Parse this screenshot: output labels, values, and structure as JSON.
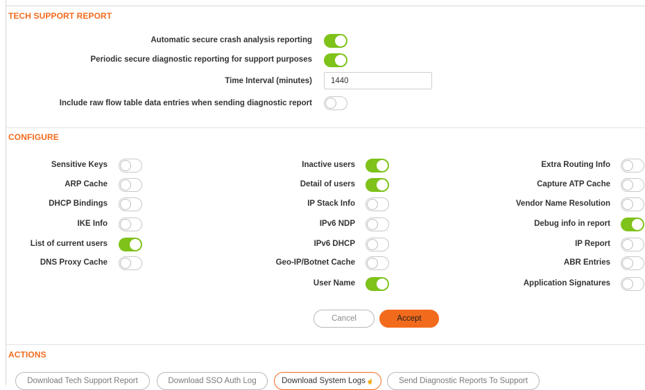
{
  "tech_support": {
    "title": "TECH SUPPORT REPORT",
    "auto_crash_label": "Automatic secure crash analysis reporting",
    "auto_crash_on": true,
    "periodic_label": "Periodic secure diagnostic reporting for support purposes",
    "periodic_on": true,
    "interval_label": "Time Interval (minutes)",
    "interval_value": "1440",
    "raw_flow_label": "Include raw flow table data entries when sending diagnostic report",
    "raw_flow_on": false
  },
  "configure": {
    "title": "CONFIGURE",
    "col1": [
      {
        "label": "Sensitive Keys",
        "on": false
      },
      {
        "label": "ARP Cache",
        "on": false
      },
      {
        "label": "DHCP Bindings",
        "on": false
      },
      {
        "label": "IKE Info",
        "on": false
      },
      {
        "label": "List of current users",
        "on": true
      },
      {
        "label": "DNS Proxy Cache",
        "on": false
      }
    ],
    "col2": [
      {
        "label": "Inactive users",
        "on": true
      },
      {
        "label": "Detail of users",
        "on": true
      },
      {
        "label": "IP Stack Info",
        "on": false
      },
      {
        "label": "IPv6 NDP",
        "on": false
      },
      {
        "label": "IPv6 DHCP",
        "on": false
      },
      {
        "label": "Geo-IP/Botnet Cache",
        "on": false
      },
      {
        "label": "User Name",
        "on": true
      }
    ],
    "col3": [
      {
        "label": "Extra Routing Info",
        "on": false
      },
      {
        "label": "Capture ATP Cache",
        "on": false
      },
      {
        "label": "Vendor Name Resolution",
        "on": false
      },
      {
        "label": "Debug info in report",
        "on": true
      },
      {
        "label": "IP Report",
        "on": false
      },
      {
        "label": "ABR Entries",
        "on": false
      },
      {
        "label": "Application Signatures",
        "on": false
      }
    ],
    "cancel_label": "Cancel",
    "accept_label": "Accept"
  },
  "actions": {
    "title": "ACTIONS",
    "download_tech_support": "Download Tech Support Report",
    "download_sso": "Download SSO Auth Log",
    "download_system_logs": "Download System Logs",
    "send_diagnostic": "Send Diagnostic Reports To Support"
  },
  "colors": {
    "accent": "#f26b1d",
    "toggle_on": "#7ec21a"
  }
}
